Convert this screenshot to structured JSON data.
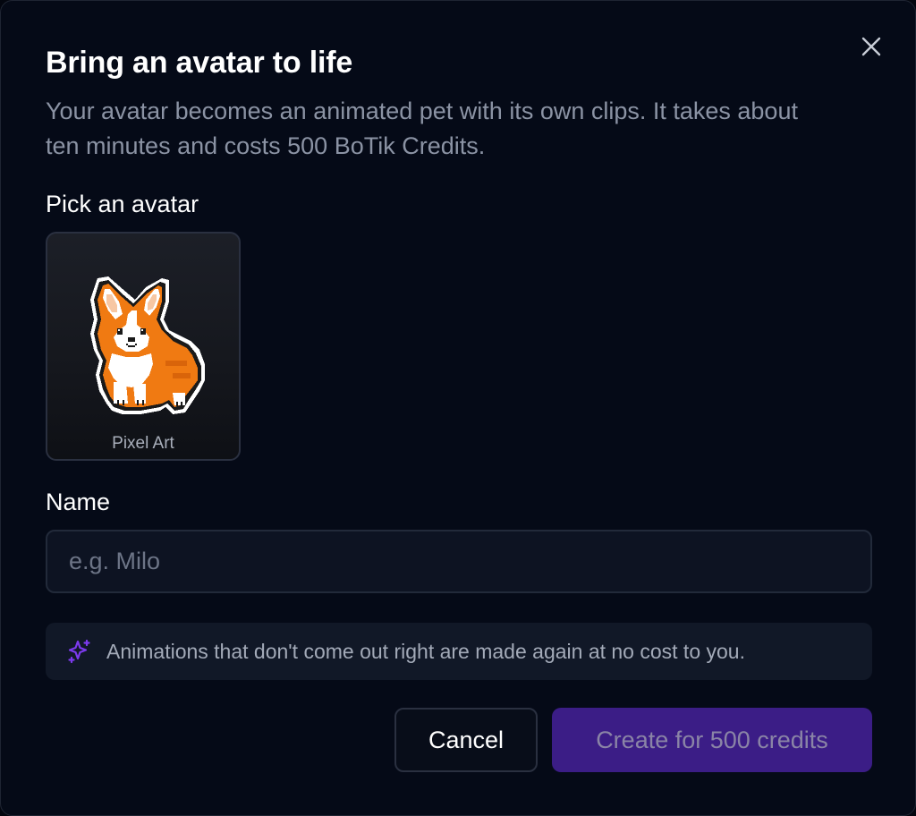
{
  "dialog": {
    "title": "Bring an avatar to life",
    "subtitle": "Your avatar becomes an animated pet with its own clips. It takes about ten minutes and costs 500 BoTik Credits.",
    "close_icon": "close-icon"
  },
  "avatar_section": {
    "label": "Pick an avatar",
    "avatars": [
      {
        "caption": "Pixel Art",
        "image": "pixel-corgi"
      }
    ]
  },
  "name_section": {
    "label": "Name",
    "value": "",
    "placeholder": "e.g. Milo"
  },
  "notice": {
    "icon": "sparkles-icon",
    "text": "Animations that don't come out right are made again at no cost to you."
  },
  "actions": {
    "cancel_label": "Cancel",
    "create_label": "Create for 500 credits"
  },
  "colors": {
    "background": "#050a17",
    "primary_button": "#3b1d86",
    "accent_icon": "#7c3aed"
  }
}
